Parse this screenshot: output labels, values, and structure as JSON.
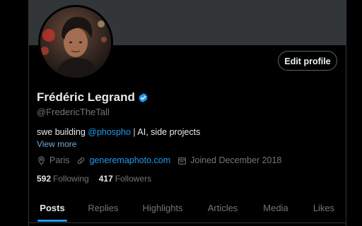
{
  "profile": {
    "name": "Frédéric Legrand",
    "handle": "@FredericTheTall",
    "bio_prefix": "swe building ",
    "bio_mention": "@phospho",
    "bio_suffix": " | AI, side projects",
    "view_more": "View more",
    "location": "Paris",
    "website": "generemaphoto.com",
    "joined": "Joined December 2018",
    "following_count": "592",
    "following_label": "Following",
    "followers_count": "417",
    "followers_label": "Followers"
  },
  "actions": {
    "edit_profile": "Edit profile"
  },
  "tabs": [
    {
      "label": "Posts",
      "active": true
    },
    {
      "label": "Replies",
      "active": false
    },
    {
      "label": "Highlights",
      "active": false
    },
    {
      "label": "Articles",
      "active": false
    },
    {
      "label": "Media",
      "active": false
    },
    {
      "label": "Likes",
      "active": false
    }
  ],
  "colors": {
    "background": "#000000",
    "banner": "#333639",
    "accent": "#1d9bf0",
    "secondary_text": "#71767b",
    "primary_text": "#e7e9ea"
  },
  "icons": {
    "verified": "verified-badge-icon",
    "location": "location-pin-icon",
    "website": "link-icon",
    "joined": "calendar-icon"
  }
}
